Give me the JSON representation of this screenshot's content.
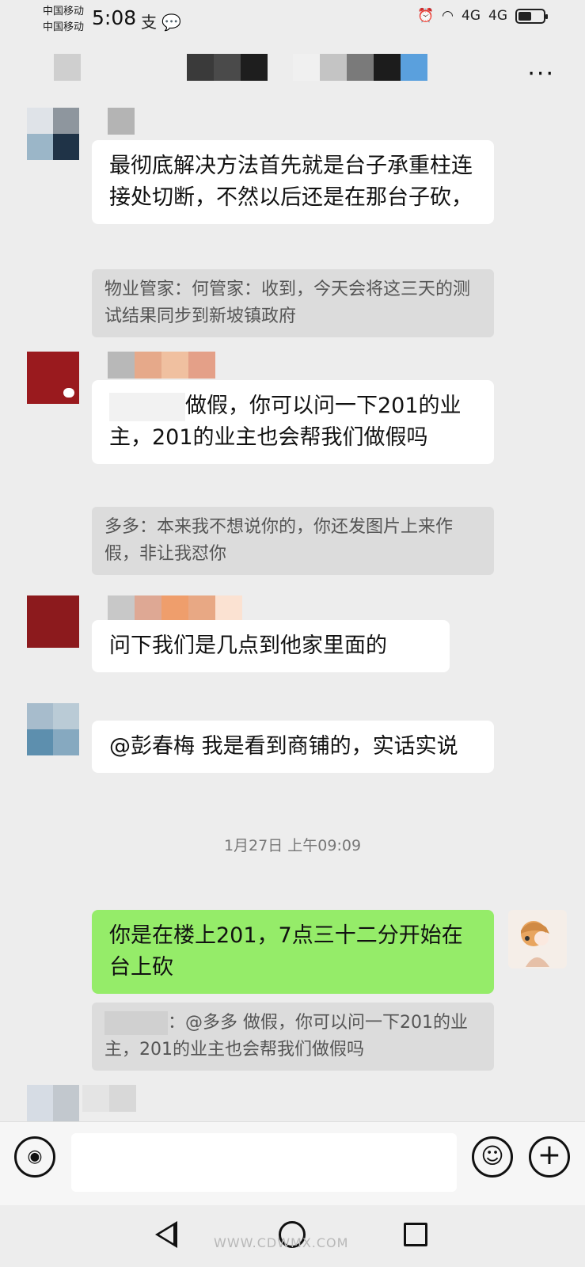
{
  "status_bar": {
    "carrier1": "中国移动",
    "carrier2": "中国移动",
    "time": "5:08",
    "notif_icons": "支 💬",
    "network1": "4G",
    "network2": "4G"
  },
  "header": {
    "more_icon": "more-icon"
  },
  "messages": [
    {
      "text": "最彻底解决方法首先就是台子承重柱连接处切断，不然以后还是在那台子砍，",
      "quote": "物业管家：何管家：收到，今天会将这三天的测试结果同步到新坡镇政府"
    },
    {
      "text": "做假，你可以问一下201的业主，201的业主也会帮我们做假吗",
      "quote": "多多：本来我不想说你的，你还发图片上来作假，非让我怼你"
    },
    {
      "text": "问下我们是几点到他家里面的"
    },
    {
      "text": "@彭春梅  我是看到商铺的，实话实说"
    }
  ],
  "timestamp": "1月27日 上午09:09",
  "my_message": {
    "text": "你是在楼上201，7点三十二分开始在台上砍",
    "quote": "：@多多 做假，你可以问一下201的业主，201的业主也会帮我们做假吗"
  },
  "input": {
    "placeholder": ""
  },
  "watermark": "WWW.CDWMX.COM",
  "colors": {
    "background": "#ededed",
    "my_bubble": "#95ec69",
    "other_bubble": "#ffffff",
    "quote_bg": "#dcdcdc"
  }
}
